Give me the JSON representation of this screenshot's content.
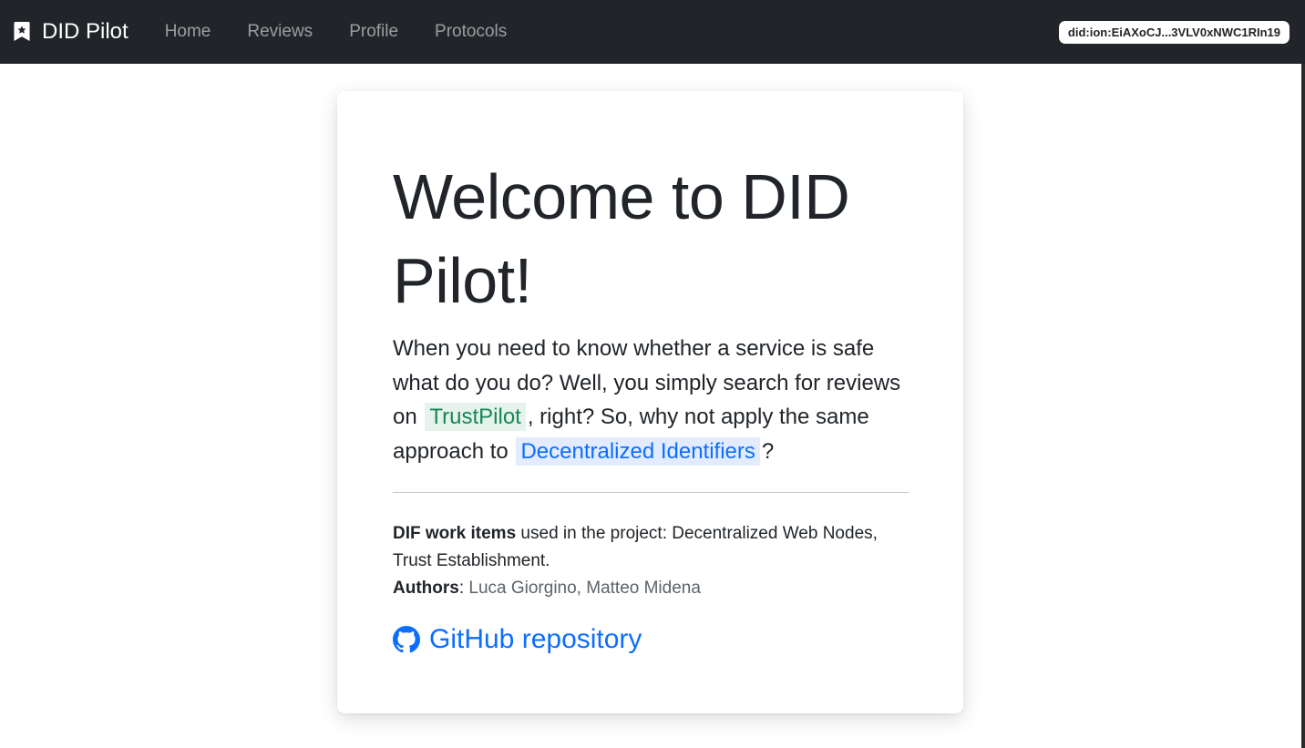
{
  "navbar": {
    "brand_icon": "bookmark-star-icon",
    "brand": "DID Pilot",
    "links": [
      {
        "label": "Home"
      },
      {
        "label": "Reviews"
      },
      {
        "label": "Profile"
      },
      {
        "label": "Protocols"
      }
    ],
    "did": "did:ion:EiAXoCJ...3VLV0xNWC1RIn19"
  },
  "hero": {
    "title_light": "Welcome to ",
    "title_bold_1": "DID",
    "title_bold_2": "Pilot!",
    "lead_1": "When you need to know whether a service is safe what do you do? Well, you simply search for reviews on ",
    "trustpilot": "TrustPilot",
    "lead_2": ", right? So, why not apply the same approach to ",
    "dids": "Decentralized Identifiers",
    "lead_3": "?"
  },
  "info": {
    "work_items_label": "DIF work items",
    "work_items_text": " used in the project: Decentralized Web Nodes, Trust Establishment.",
    "authors_label": "Authors",
    "authors_sep": ": ",
    "authors": "Luca Giorgino, Matteo Midena"
  },
  "github": {
    "icon": "github-icon",
    "label": "GitHub repository"
  },
  "colors": {
    "navbar_bg": "#212529",
    "link_blue": "#0d6efd",
    "link_green": "#198754"
  }
}
